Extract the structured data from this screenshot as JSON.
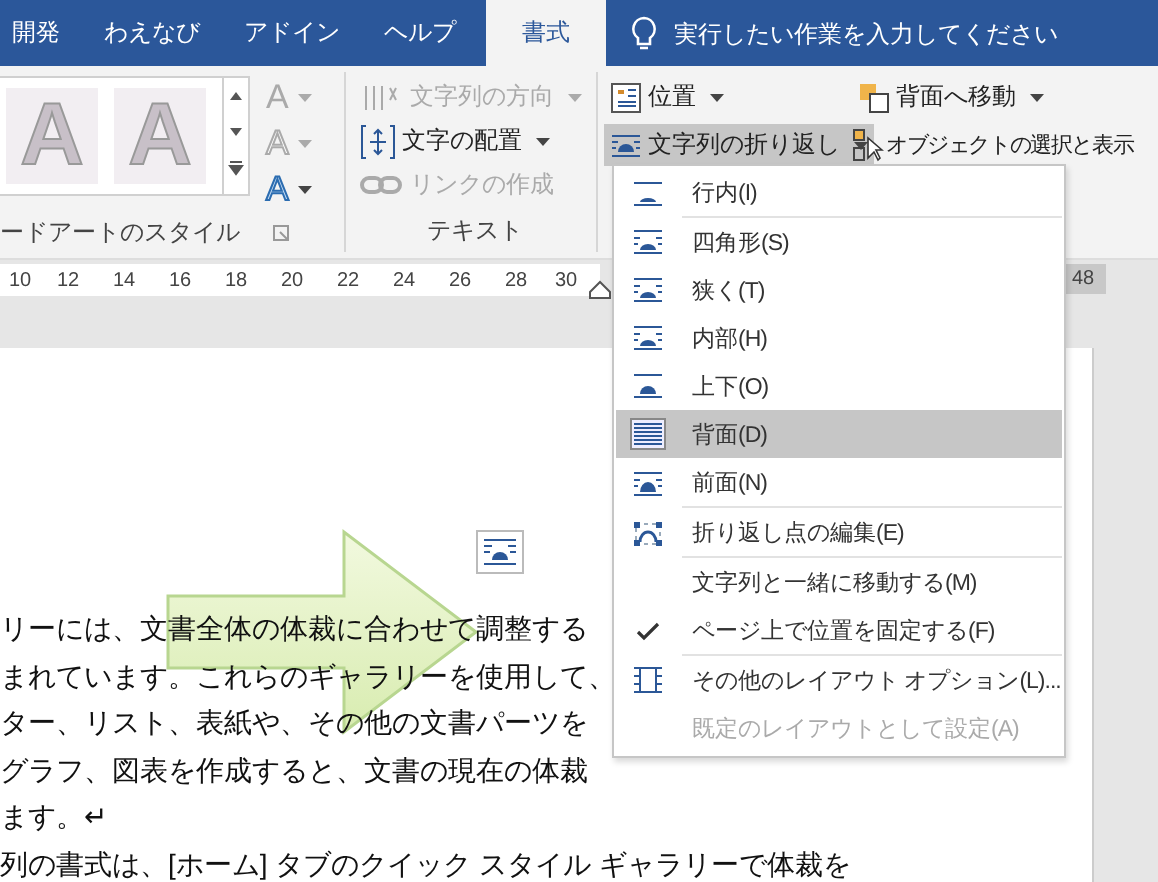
{
  "tabs": [
    {
      "label": "開発",
      "selected": false
    },
    {
      "label": "わえなび",
      "selected": false
    },
    {
      "label": "アドイン",
      "selected": false
    },
    {
      "label": "ヘルプ",
      "selected": false
    },
    {
      "label": "書式",
      "selected": true
    }
  ],
  "tell_me": {
    "placeholder": "実行したい作業を入力してください"
  },
  "wordart_group": {
    "label": "ードアートのスタイル",
    "samples": [
      "A",
      "A"
    ],
    "buttons": [
      {
        "label": "A",
        "disabled": true
      },
      {
        "label": "A",
        "disabled": true
      },
      {
        "label": "A",
        "disabled": false
      }
    ]
  },
  "text_group": {
    "label": "テキスト",
    "buttons": [
      {
        "label": "文字列の方向",
        "disabled": true,
        "dropdown": true
      },
      {
        "label": "文字の配置",
        "disabled": false,
        "dropdown": true
      },
      {
        "label": "リンクの作成",
        "disabled": true,
        "dropdown": false
      }
    ]
  },
  "arrange_group": {
    "buttons": [
      {
        "label": "位置",
        "pressed": false,
        "dropdown": true
      },
      {
        "label": "背面へ移動",
        "pressed": false,
        "dropdown": true
      },
      {
        "label": "文字列の折り返し",
        "pressed": true,
        "dropdown": true
      },
      {
        "label": "オブジェクトの選択と表示",
        "pressed": false
      }
    ]
  },
  "ruler": {
    "numbers": [
      "10",
      "12",
      "14",
      "16",
      "18",
      "20",
      "22",
      "24",
      "26",
      "28",
      "30"
    ],
    "right_number": "48"
  },
  "document": {
    "lines": [
      "リーには、文書全体の体裁に合わせて調整する",
      "まれています。これらのギャラリーを使用して、",
      "ター、リスト、表紙や、その他の文書パーツを",
      "グラフ、図表を作成すると、文書の現在の体裁",
      "ます。↵",
      "列の書式は、[ホーム] タブのクイック スタイル ギャラリーで体裁を"
    ]
  },
  "wrap_menu": {
    "items": [
      {
        "kind": "wrap",
        "label": "行内(I)",
        "selected": false,
        "separator_after": true
      },
      {
        "kind": "wrap",
        "label": "四角形(S)",
        "selected": false,
        "separator_after": false
      },
      {
        "kind": "wrap",
        "label": "狭く(T)",
        "selected": false,
        "separator_after": false
      },
      {
        "kind": "wrap",
        "label": "内部(H)",
        "selected": false,
        "separator_after": false
      },
      {
        "kind": "wrap",
        "label": "上下(O)",
        "selected": false,
        "separator_after": false
      },
      {
        "kind": "wrap",
        "label": "背面(D)",
        "selected": true,
        "separator_after": false
      },
      {
        "kind": "wrap",
        "label": "前面(N)",
        "selected": false,
        "separator_after": true
      },
      {
        "kind": "edit",
        "label": "折り返し点の編集(E)",
        "separator_after": true
      },
      {
        "kind": "check",
        "label": "文字列と一緒に移動する(M)",
        "checked": false,
        "separator_after": false
      },
      {
        "kind": "check",
        "label": "ページ上で位置を固定する(F)",
        "checked": true,
        "separator_after": true
      },
      {
        "kind": "options",
        "label": "その他のレイアウト オプション(L)...",
        "disabled": false,
        "separator_after": false
      },
      {
        "kind": "options",
        "label": "既定のレイアウトとして設定(A)",
        "disabled": true,
        "separator_after": false
      }
    ]
  }
}
